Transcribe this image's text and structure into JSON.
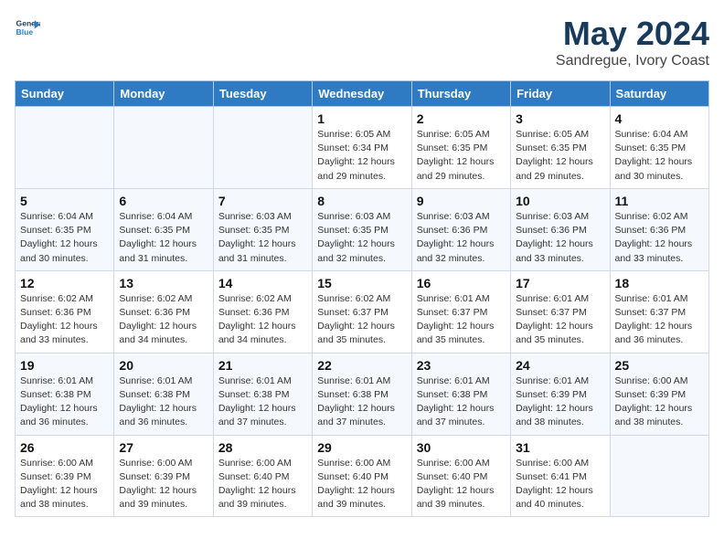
{
  "logo": {
    "line1": "General",
    "line2": "Blue"
  },
  "calendar": {
    "title": "May 2024",
    "subtitle": "Sandregue, Ivory Coast"
  },
  "headers": [
    "Sunday",
    "Monday",
    "Tuesday",
    "Wednesday",
    "Thursday",
    "Friday",
    "Saturday"
  ],
  "weeks": [
    [
      {
        "day": "",
        "info": ""
      },
      {
        "day": "",
        "info": ""
      },
      {
        "day": "",
        "info": ""
      },
      {
        "day": "1",
        "info": "Sunrise: 6:05 AM\nSunset: 6:34 PM\nDaylight: 12 hours\nand 29 minutes."
      },
      {
        "day": "2",
        "info": "Sunrise: 6:05 AM\nSunset: 6:35 PM\nDaylight: 12 hours\nand 29 minutes."
      },
      {
        "day": "3",
        "info": "Sunrise: 6:05 AM\nSunset: 6:35 PM\nDaylight: 12 hours\nand 29 minutes."
      },
      {
        "day": "4",
        "info": "Sunrise: 6:04 AM\nSunset: 6:35 PM\nDaylight: 12 hours\nand 30 minutes."
      }
    ],
    [
      {
        "day": "5",
        "info": "Sunrise: 6:04 AM\nSunset: 6:35 PM\nDaylight: 12 hours\nand 30 minutes."
      },
      {
        "day": "6",
        "info": "Sunrise: 6:04 AM\nSunset: 6:35 PM\nDaylight: 12 hours\nand 31 minutes."
      },
      {
        "day": "7",
        "info": "Sunrise: 6:03 AM\nSunset: 6:35 PM\nDaylight: 12 hours\nand 31 minutes."
      },
      {
        "day": "8",
        "info": "Sunrise: 6:03 AM\nSunset: 6:35 PM\nDaylight: 12 hours\nand 32 minutes."
      },
      {
        "day": "9",
        "info": "Sunrise: 6:03 AM\nSunset: 6:36 PM\nDaylight: 12 hours\nand 32 minutes."
      },
      {
        "day": "10",
        "info": "Sunrise: 6:03 AM\nSunset: 6:36 PM\nDaylight: 12 hours\nand 33 minutes."
      },
      {
        "day": "11",
        "info": "Sunrise: 6:02 AM\nSunset: 6:36 PM\nDaylight: 12 hours\nand 33 minutes."
      }
    ],
    [
      {
        "day": "12",
        "info": "Sunrise: 6:02 AM\nSunset: 6:36 PM\nDaylight: 12 hours\nand 33 minutes."
      },
      {
        "day": "13",
        "info": "Sunrise: 6:02 AM\nSunset: 6:36 PM\nDaylight: 12 hours\nand 34 minutes."
      },
      {
        "day": "14",
        "info": "Sunrise: 6:02 AM\nSunset: 6:36 PM\nDaylight: 12 hours\nand 34 minutes."
      },
      {
        "day": "15",
        "info": "Sunrise: 6:02 AM\nSunset: 6:37 PM\nDaylight: 12 hours\nand 35 minutes."
      },
      {
        "day": "16",
        "info": "Sunrise: 6:01 AM\nSunset: 6:37 PM\nDaylight: 12 hours\nand 35 minutes."
      },
      {
        "day": "17",
        "info": "Sunrise: 6:01 AM\nSunset: 6:37 PM\nDaylight: 12 hours\nand 35 minutes."
      },
      {
        "day": "18",
        "info": "Sunrise: 6:01 AM\nSunset: 6:37 PM\nDaylight: 12 hours\nand 36 minutes."
      }
    ],
    [
      {
        "day": "19",
        "info": "Sunrise: 6:01 AM\nSunset: 6:38 PM\nDaylight: 12 hours\nand 36 minutes."
      },
      {
        "day": "20",
        "info": "Sunrise: 6:01 AM\nSunset: 6:38 PM\nDaylight: 12 hours\nand 36 minutes."
      },
      {
        "day": "21",
        "info": "Sunrise: 6:01 AM\nSunset: 6:38 PM\nDaylight: 12 hours\nand 37 minutes."
      },
      {
        "day": "22",
        "info": "Sunrise: 6:01 AM\nSunset: 6:38 PM\nDaylight: 12 hours\nand 37 minutes."
      },
      {
        "day": "23",
        "info": "Sunrise: 6:01 AM\nSunset: 6:38 PM\nDaylight: 12 hours\nand 37 minutes."
      },
      {
        "day": "24",
        "info": "Sunrise: 6:01 AM\nSunset: 6:39 PM\nDaylight: 12 hours\nand 38 minutes."
      },
      {
        "day": "25",
        "info": "Sunrise: 6:00 AM\nSunset: 6:39 PM\nDaylight: 12 hours\nand 38 minutes."
      }
    ],
    [
      {
        "day": "26",
        "info": "Sunrise: 6:00 AM\nSunset: 6:39 PM\nDaylight: 12 hours\nand 38 minutes."
      },
      {
        "day": "27",
        "info": "Sunrise: 6:00 AM\nSunset: 6:39 PM\nDaylight: 12 hours\nand 39 minutes."
      },
      {
        "day": "28",
        "info": "Sunrise: 6:00 AM\nSunset: 6:40 PM\nDaylight: 12 hours\nand 39 minutes."
      },
      {
        "day": "29",
        "info": "Sunrise: 6:00 AM\nSunset: 6:40 PM\nDaylight: 12 hours\nand 39 minutes."
      },
      {
        "day": "30",
        "info": "Sunrise: 6:00 AM\nSunset: 6:40 PM\nDaylight: 12 hours\nand 39 minutes."
      },
      {
        "day": "31",
        "info": "Sunrise: 6:00 AM\nSunset: 6:41 PM\nDaylight: 12 hours\nand 40 minutes."
      },
      {
        "day": "",
        "info": ""
      }
    ]
  ]
}
